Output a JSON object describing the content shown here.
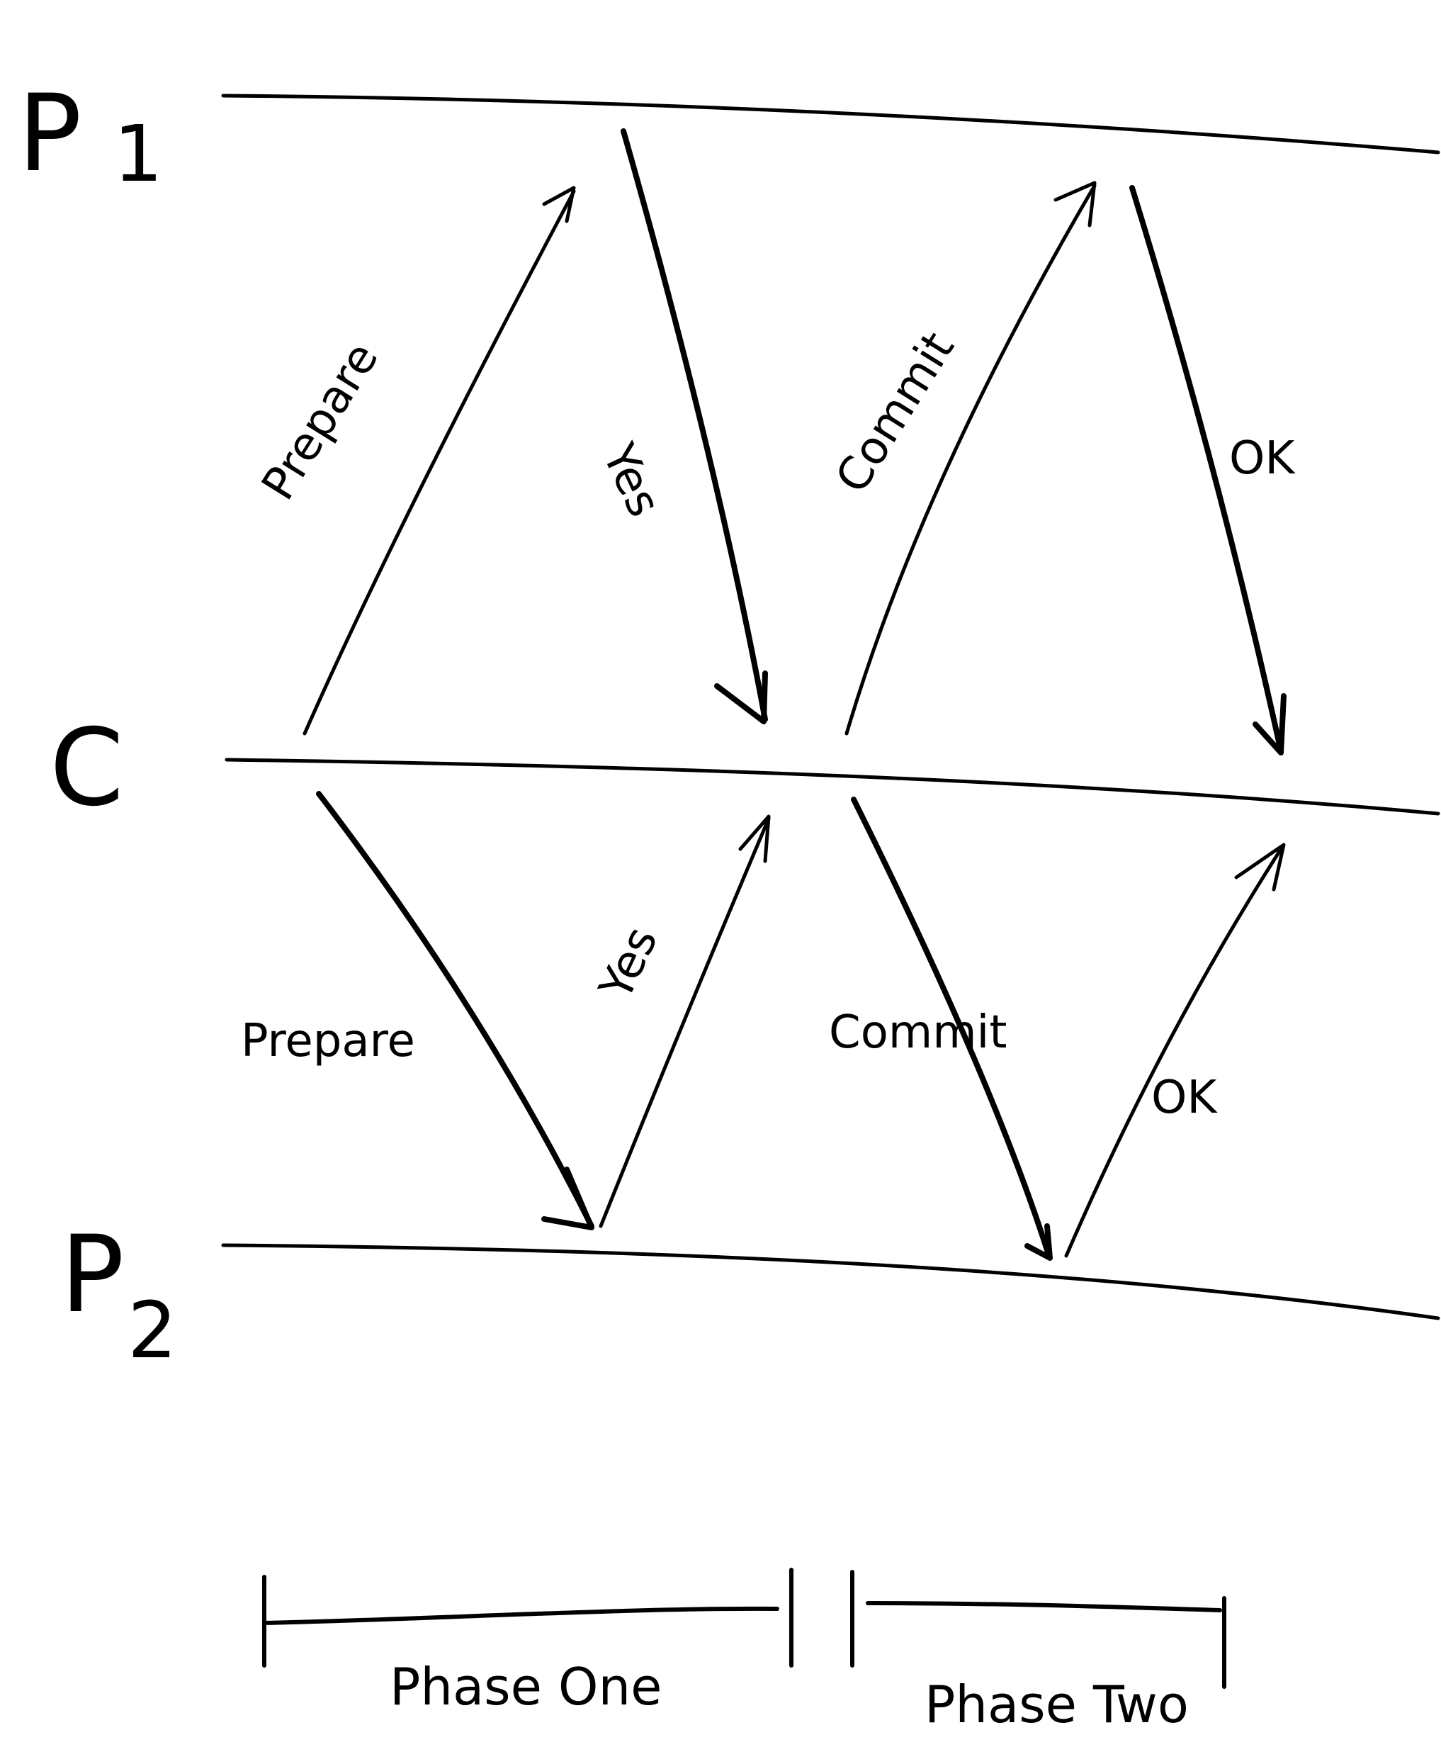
{
  "processes": {
    "p1": {
      "name": "P",
      "sub": "1"
    },
    "c": {
      "name": "C"
    },
    "p2": {
      "name": "P",
      "sub": "2"
    }
  },
  "messages": {
    "prepare_to_p1": "Prepare",
    "yes_from_p1": "Yes",
    "commit_to_p1": "Commit",
    "ok_from_p1": "OK",
    "prepare_to_p2": "Prepare",
    "yes_from_p2": "Yes",
    "commit_to_p2": "Commit",
    "ok_from_p2": "OK"
  },
  "phases": {
    "one": "Phase One",
    "two": "Phase Two"
  }
}
